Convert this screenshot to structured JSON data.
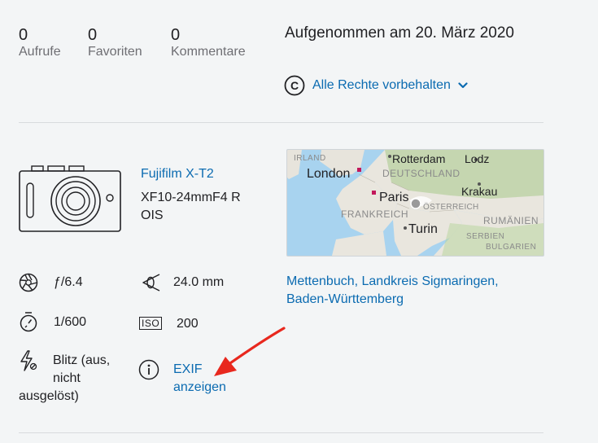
{
  "stats": [
    {
      "value": "0",
      "label": "Aufrufe"
    },
    {
      "value": "0",
      "label": "Favoriten"
    },
    {
      "value": "0",
      "label": "Kommentare"
    }
  ],
  "taken": "Aufgenommen am 20. März 2020",
  "license": {
    "label": "Alle Rechte vorbehalten"
  },
  "camera": {
    "brand": "Fujifilm X-T2",
    "lens_line1": "XF10-24mmF4 R",
    "lens_line2": "OIS"
  },
  "exif": {
    "aperture": "ƒ/6.4",
    "focal": "24.0 mm",
    "shutter": "1/600",
    "iso_label": "ISO",
    "iso": "200",
    "flash_line1": "Blitz (aus,",
    "flash_line2": "nicht",
    "flash_line3": "ausgelöst)",
    "link_line1": "EXIF",
    "link_line2": "anzeigen"
  },
  "location": {
    "line1": "Mettenbuch, Landkreis Sigmaringen,",
    "line2": "Baden-Württemberg"
  },
  "map_labels": {
    "irland": "IRLAND",
    "london": "London",
    "rotterdam": "Rotterdam",
    "lodz": "Lodz",
    "deutschland": "DEUTSCHLAND",
    "krakau": "Krakau",
    "paris": "Paris",
    "frankreich": "FRANKREICH",
    "oesterreich": "ÖSTERREICH",
    "rumaenien": "RUMÄNIEN",
    "turin": "Turin",
    "serbien": "SERBIEN",
    "bulgarien": "BULGARIEN"
  },
  "colors": {
    "link": "#0b6bb1",
    "annotation_arrow": "#e8281e"
  }
}
